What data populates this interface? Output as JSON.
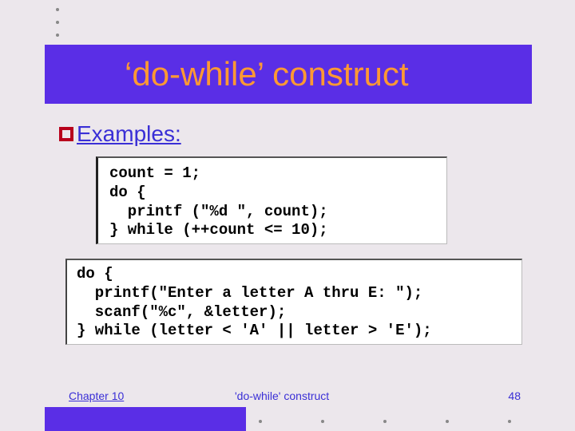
{
  "title": "‘do-while’ construct",
  "bullet_label": "Examples:",
  "code1": "count = 1;\ndo {\n  printf (\"%d \", count);\n} while (++count <= 10);",
  "code2": "do {\n  printf(\"Enter a letter A thru E: \");\n  scanf(\"%c\", &letter);\n} while (letter < 'A' || letter > 'E');",
  "footer": {
    "chapter": "Chapter 10",
    "center": "'do-while' construct",
    "page": "48"
  }
}
